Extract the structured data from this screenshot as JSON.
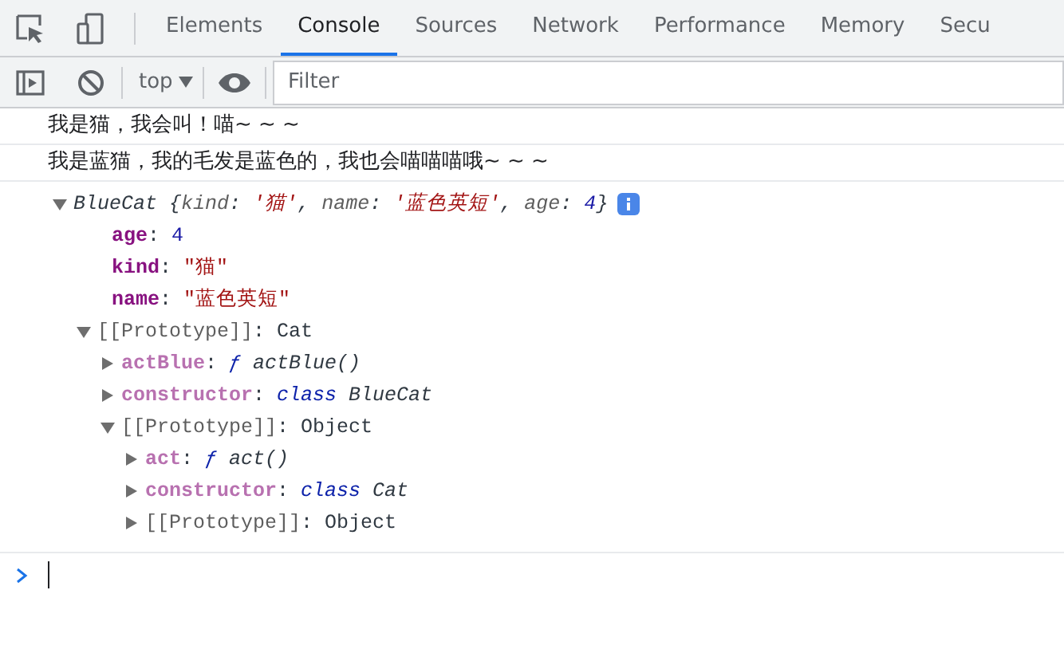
{
  "tabs": [
    {
      "label": "Elements",
      "selected": false
    },
    {
      "label": "Console",
      "selected": true
    },
    {
      "label": "Sources",
      "selected": false
    },
    {
      "label": "Network",
      "selected": false
    },
    {
      "label": "Performance",
      "selected": false
    },
    {
      "label": "Memory",
      "selected": false
    },
    {
      "label": "Secu",
      "selected": false
    }
  ],
  "toolbar": {
    "context": "top",
    "filter": {
      "placeholder": "Filter"
    }
  },
  "messages": [
    "我是猫，我会叫！喵~ ~ ~",
    "我是蓝猫，我的毛发是蓝色的，我也会喵喵喵哦~ ~ ~"
  ],
  "tree": [
    {
      "expanded": true,
      "info": true,
      "segments": [
        {
          "text": "BlueCat {",
          "kind": "summary"
        },
        {
          "text": "kind",
          "kind": "summary-key"
        },
        {
          "text": ": ",
          "kind": "summary"
        },
        {
          "text": "'猫'",
          "kind": "string-italic"
        },
        {
          "text": ", ",
          "kind": "summary"
        },
        {
          "text": "name",
          "kind": "summary-key"
        },
        {
          "text": ": ",
          "kind": "summary"
        },
        {
          "text": "'蓝色英短'",
          "kind": "string-italic"
        },
        {
          "text": ", ",
          "kind": "summary"
        },
        {
          "text": "age",
          "kind": "summary-key"
        },
        {
          "text": ": ",
          "kind": "summary"
        },
        {
          "text": "4",
          "kind": "number-italic"
        },
        {
          "text": "}",
          "kind": "summary"
        }
      ],
      "children": [
        {
          "segments": [
            {
              "text": "age",
              "kind": "key"
            },
            {
              "text": ": ",
              "kind": "punct"
            },
            {
              "text": "4",
              "kind": "number"
            }
          ]
        },
        {
          "segments": [
            {
              "text": "kind",
              "kind": "key"
            },
            {
              "text": ": ",
              "kind": "punct"
            },
            {
              "text": "\"猫\"",
              "kind": "string"
            }
          ]
        },
        {
          "segments": [
            {
              "text": "name",
              "kind": "key"
            },
            {
              "text": ": ",
              "kind": "punct"
            },
            {
              "text": "\"蓝色英短\"",
              "kind": "string"
            }
          ]
        },
        {
          "expanded": true,
          "segments": [
            {
              "text": "[[Prototype]]",
              "kind": "internal"
            },
            {
              "text": ": Cat",
              "kind": "punct"
            }
          ],
          "children": [
            {
              "expanded": false,
              "segments": [
                {
                  "text": "actBlue",
                  "kind": "key-dim"
                },
                {
                  "text": ": ",
                  "kind": "punct"
                },
                {
                  "text": "ƒ",
                  "kind": "keyword"
                },
                {
                  "text": " actBlue()",
                  "kind": "fn"
                }
              ]
            },
            {
              "expanded": false,
              "segments": [
                {
                  "text": "constructor",
                  "kind": "key-dim"
                },
                {
                  "text": ": ",
                  "kind": "punct"
                },
                {
                  "text": "class",
                  "kind": "keyword"
                },
                {
                  "text": " BlueCat",
                  "kind": "fn"
                }
              ]
            },
            {
              "expanded": true,
              "segments": [
                {
                  "text": "[[Prototype]]",
                  "kind": "internal"
                },
                {
                  "text": ": Object",
                  "kind": "punct"
                }
              ],
              "children": [
                {
                  "expanded": false,
                  "segments": [
                    {
                      "text": "act",
                      "kind": "key-dim"
                    },
                    {
                      "text": ": ",
                      "kind": "punct"
                    },
                    {
                      "text": "ƒ",
                      "kind": "keyword"
                    },
                    {
                      "text": " act()",
                      "kind": "fn"
                    }
                  ]
                },
                {
                  "expanded": false,
                  "segments": [
                    {
                      "text": "constructor",
                      "kind": "key-dim"
                    },
                    {
                      "text": ": ",
                      "kind": "punct"
                    },
                    {
                      "text": "class",
                      "kind": "keyword"
                    },
                    {
                      "text": " Cat",
                      "kind": "fn"
                    }
                  ]
                },
                {
                  "expanded": false,
                  "segments": [
                    {
                      "text": "[[Prototype]]",
                      "kind": "internal"
                    },
                    {
                      "text": ": Object",
                      "kind": "punct"
                    }
                  ]
                }
              ]
            }
          ]
        }
      ]
    }
  ]
}
